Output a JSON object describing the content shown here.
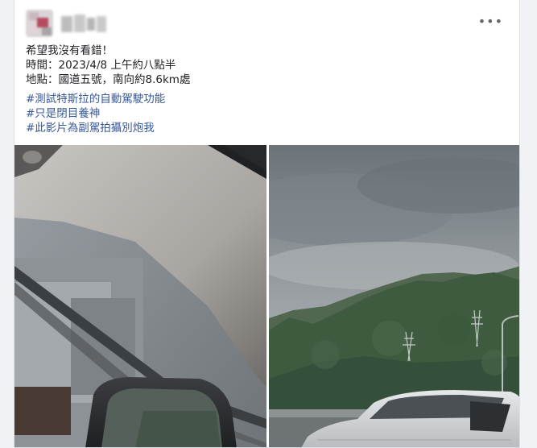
{
  "post": {
    "author": {
      "avatar_icon": "avatar-blurred",
      "name_icon": "name-blurred"
    },
    "more_icon": "more-horizontal-icon",
    "more_glyph": "•••",
    "lines": [
      "希望我沒有看錯！",
      "時間：2023/4/8 上午約八點半",
      "地點：國道五號，南向約8.6km處"
    ],
    "hashtags": [
      "#測試特斯拉的自動駕駛功能",
      "#只是閉目養神",
      "#此影片為副駕拍攝別炮我"
    ],
    "colors": {
      "hashtag": "#385898",
      "text": "#1c1e21",
      "page_bg": "#f0f2f5"
    },
    "photos": [
      {
        "name": "car-interior-photo",
        "subject": "car-interior-side-window-mirror"
      },
      {
        "name": "highway-mountain-photo",
        "subject": "white-car-on-highway-with-mountains"
      }
    ]
  }
}
